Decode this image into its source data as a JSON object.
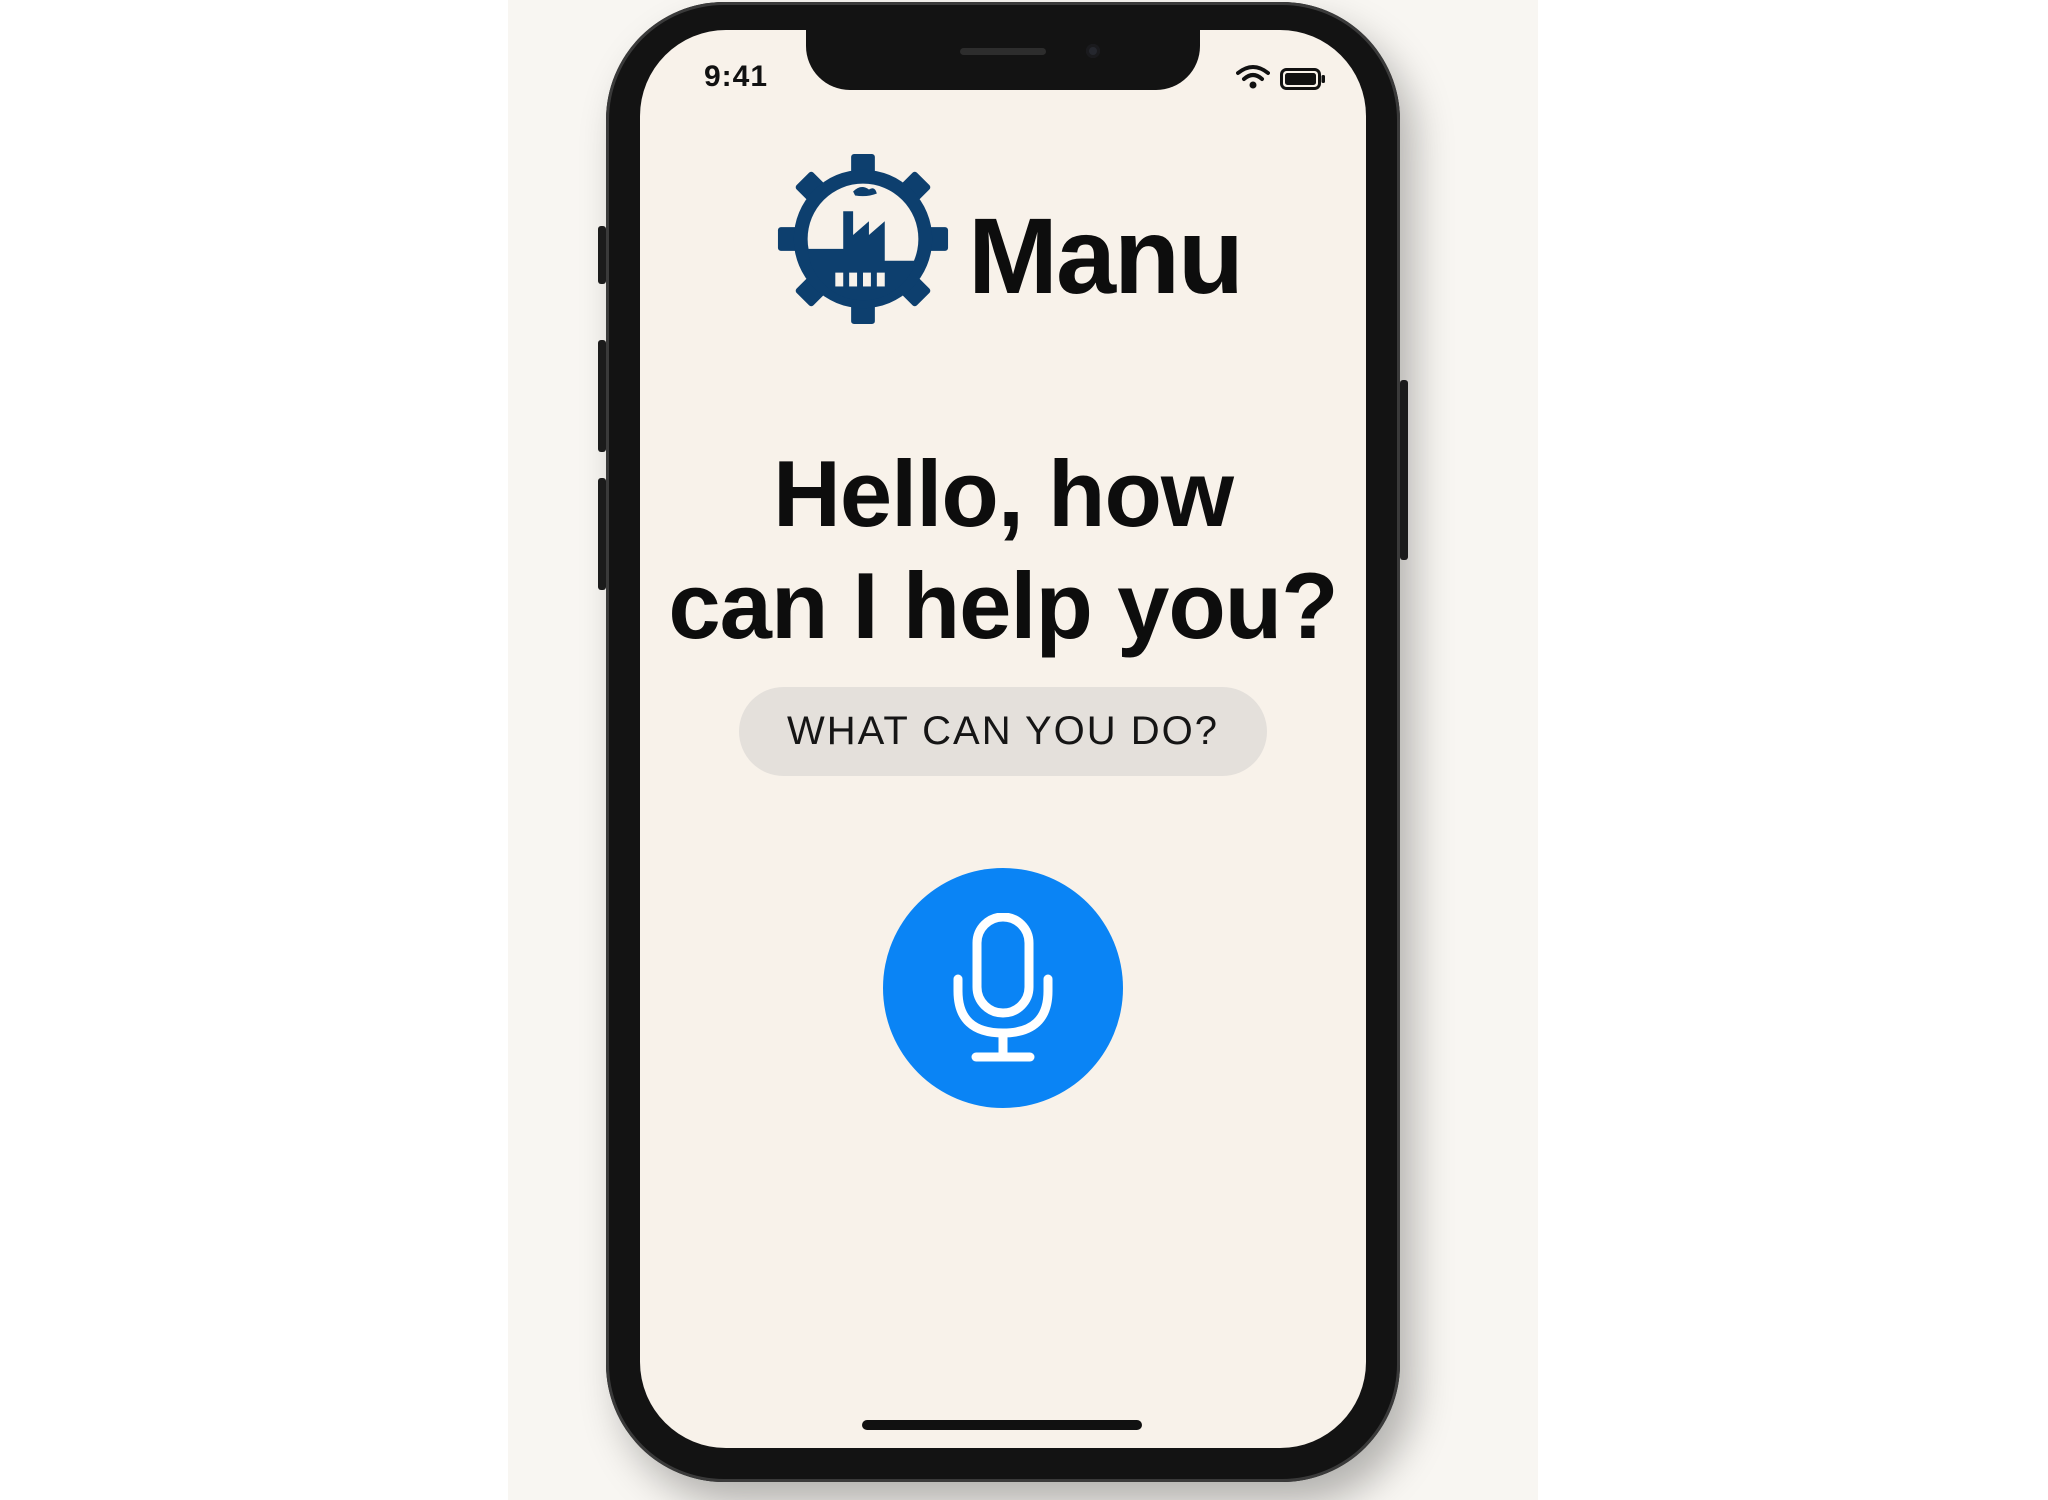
{
  "status_bar": {
    "time": "9:41",
    "wifi_icon": "wifi-icon",
    "battery_icon": "battery-icon"
  },
  "header": {
    "logo_icon": "gear-factory-logo-icon",
    "app_name": "Manu"
  },
  "main": {
    "greeting_line1": "Hello, how",
    "greeting_line2": "can I help you?",
    "suggestion_label": "WHAT CAN YOU DO?",
    "mic_icon": "microphone-icon"
  },
  "colors": {
    "accent_blue": "#0a84f5",
    "logo_navy": "#0d3f6e",
    "screen_background": "#f8f2ea",
    "pill_background": "#e4e0db"
  }
}
